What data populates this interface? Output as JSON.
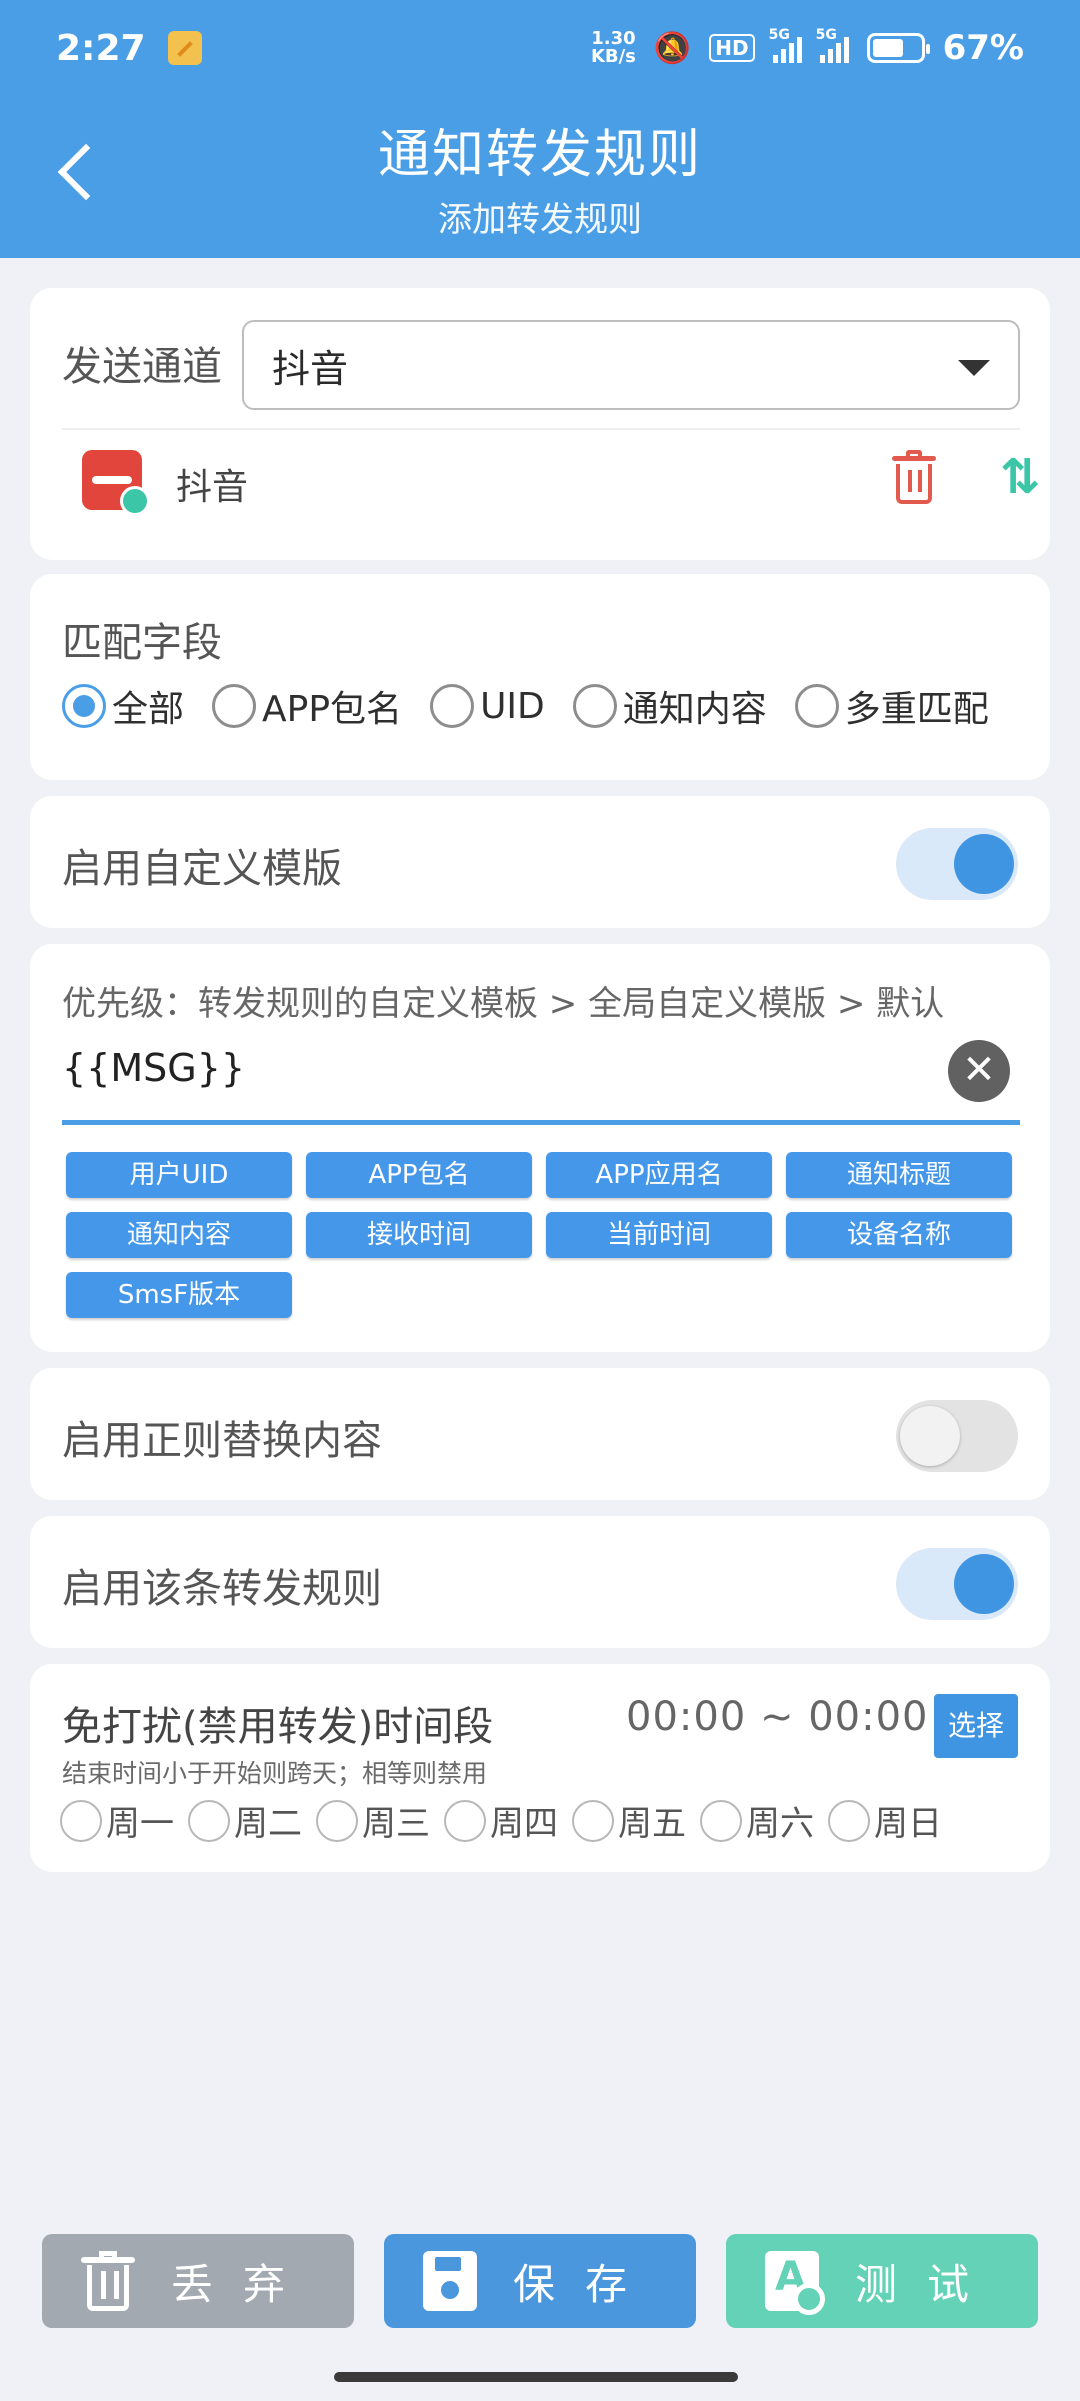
{
  "status_bar": {
    "time": "2:27",
    "net_speed_value": "1.30",
    "net_speed_unit": "KB/s",
    "hd": "HD",
    "signal1": "5G",
    "signal2": "5G",
    "battery_percent": "67%",
    "battery_level": 0.67
  },
  "header": {
    "title": "通知转发规则",
    "subtitle": "添加转发规则"
  },
  "channel": {
    "label": "发送通道",
    "selected": "抖音",
    "app_name": "抖音"
  },
  "match": {
    "label": "匹配字段",
    "options": [
      "全部",
      "APP包名",
      "UID",
      "通知内容",
      "多重匹配"
    ],
    "selected_index": 0
  },
  "custom_template": {
    "label": "启用自定义模版",
    "enabled": true
  },
  "template": {
    "priority_text": "优先级：转发规则的自定义模板 > 全局自定义模版 > 默认",
    "value": "{{MSG}}",
    "chips": [
      "用户UID",
      "APP包名",
      "APP应用名",
      "通知标题",
      "通知内容",
      "接收时间",
      "当前时间",
      "设备名称",
      "SmsF版本"
    ]
  },
  "regex_replace": {
    "label": "启用正则替换内容",
    "enabled": false
  },
  "enable_rule": {
    "label": "启用该条转发规则",
    "enabled": true
  },
  "dnd": {
    "label": "免打扰(禁用转发)时间段",
    "time_range": "00:00 ~ 00:00",
    "select_label": "选择",
    "hint": "结束时间小于开始则跨天；相等则禁用",
    "weekdays": [
      "周一",
      "周二",
      "周三",
      "周四",
      "周五",
      "周六",
      "周日"
    ]
  },
  "actions": {
    "discard": "丢弃",
    "save": "保存",
    "test": "测试"
  },
  "colors": {
    "primary": "#4a9ee6",
    "discard": "#a2a9b0",
    "save": "#4a97dd",
    "test": "#63d2b6",
    "danger": "#e25a4e"
  }
}
